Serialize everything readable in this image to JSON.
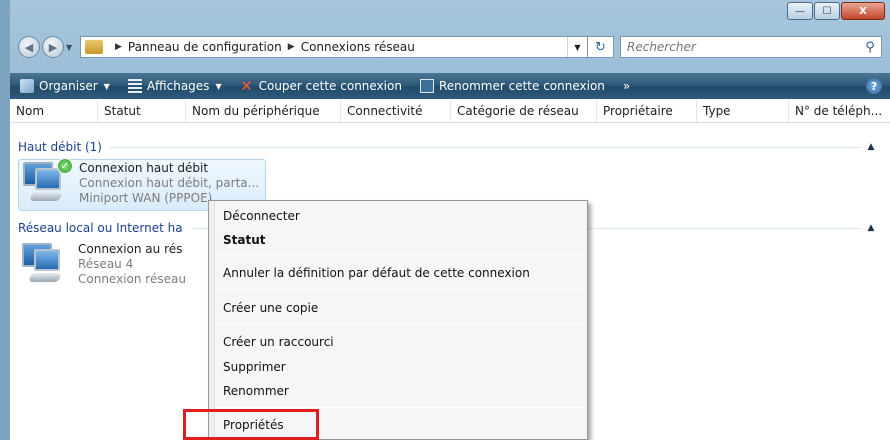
{
  "window": {
    "minimize_glyph": "—",
    "maximize_glyph": "☐",
    "close_glyph": "X"
  },
  "address": {
    "crumbs": [
      "Panneau de configuration",
      "Connexions réseau"
    ],
    "search_placeholder": "Rechercher"
  },
  "toolbar": {
    "organize": "Organiser",
    "views": "Affichages",
    "disconnect": "Couper cette connexion",
    "rename": "Renommer cette connexion",
    "more": "»"
  },
  "columns": [
    "Nom",
    "Statut",
    "Nom du périphérique",
    "Connectivité",
    "Catégorie de réseau",
    "Propriétaire",
    "Type",
    "N° de téléph..."
  ],
  "groups": [
    {
      "title": "Haut débit (1)",
      "item": {
        "name": "Connexion haut débit",
        "line2": "Connexion haut débit, parta...",
        "line3": "Miniport WAN (PPPOE)"
      }
    },
    {
      "title": "Réseau local ou Internet ha",
      "item": {
        "name": "Connexion au rés",
        "line2": "Réseau 4",
        "line3": "Connexion réseau"
      }
    }
  ],
  "context_menu": {
    "items": [
      {
        "label": "Déconnecter",
        "bold": false
      },
      {
        "label": "Statut",
        "bold": true
      },
      {
        "label": "Annuler la définition par défaut de cette connexion",
        "bold": false
      },
      {
        "label": "Créer une copie",
        "bold": false
      },
      {
        "label": "Créer un raccourci",
        "bold": false
      },
      {
        "label": "Supprimer",
        "bold": false
      },
      {
        "label": "Renommer",
        "bold": false
      },
      {
        "label": "Propriétés",
        "bold": false
      }
    ]
  },
  "colors": {
    "highlight_box": "#e21d1d",
    "group_header_text": "#1d3f8f",
    "toolbar_bg": "#2c5676"
  }
}
